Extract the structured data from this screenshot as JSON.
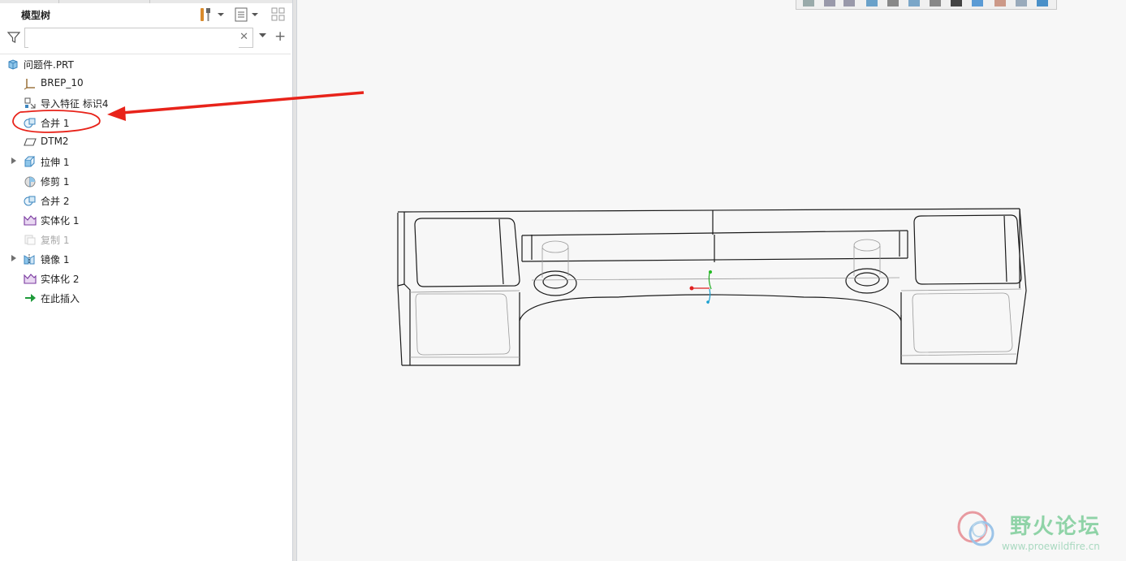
{
  "panel": {
    "title": "模型树",
    "search": {
      "value": "",
      "placeholder": ""
    }
  },
  "tree": {
    "root": "问题件.PRT",
    "items": [
      {
        "label": "BREP_10",
        "icon": "csys-icon",
        "expandable": false,
        "disabled": false
      },
      {
        "label": "导入特征 标识4",
        "icon": "import-feature-icon",
        "expandable": false,
        "disabled": false
      },
      {
        "label": "合并 1",
        "icon": "merge-icon",
        "expandable": false,
        "disabled": false,
        "highlighted": true
      },
      {
        "label": "DTM2",
        "icon": "datum-plane-icon",
        "expandable": false,
        "disabled": false
      },
      {
        "label": "拉伸 1",
        "icon": "extrude-icon",
        "expandable": true,
        "disabled": false
      },
      {
        "label": "修剪 1",
        "icon": "trim-icon",
        "expandable": false,
        "disabled": false
      },
      {
        "label": "合并 2",
        "icon": "merge-icon",
        "expandable": false,
        "disabled": false
      },
      {
        "label": "实体化 1",
        "icon": "solidify-icon",
        "expandable": false,
        "disabled": false
      },
      {
        "label": "复制 1",
        "icon": "copy-icon",
        "expandable": false,
        "disabled": true
      },
      {
        "label": "镜像 1",
        "icon": "mirror-icon",
        "expandable": true,
        "disabled": false
      },
      {
        "label": "实体化 2",
        "icon": "solidify-icon",
        "expandable": false,
        "disabled": false
      },
      {
        "label": "在此插入",
        "icon": "insert-here-arrow-icon",
        "expandable": false,
        "disabled": false
      }
    ]
  },
  "annotation": {
    "color": "#e8231a"
  },
  "watermark": {
    "name": "野火论坛",
    "url": "www.proewildfire.cn"
  },
  "colors": {
    "accent": "#1a86c8",
    "annotation": "#e8231a",
    "watermark_green": "#8fd3a7"
  }
}
